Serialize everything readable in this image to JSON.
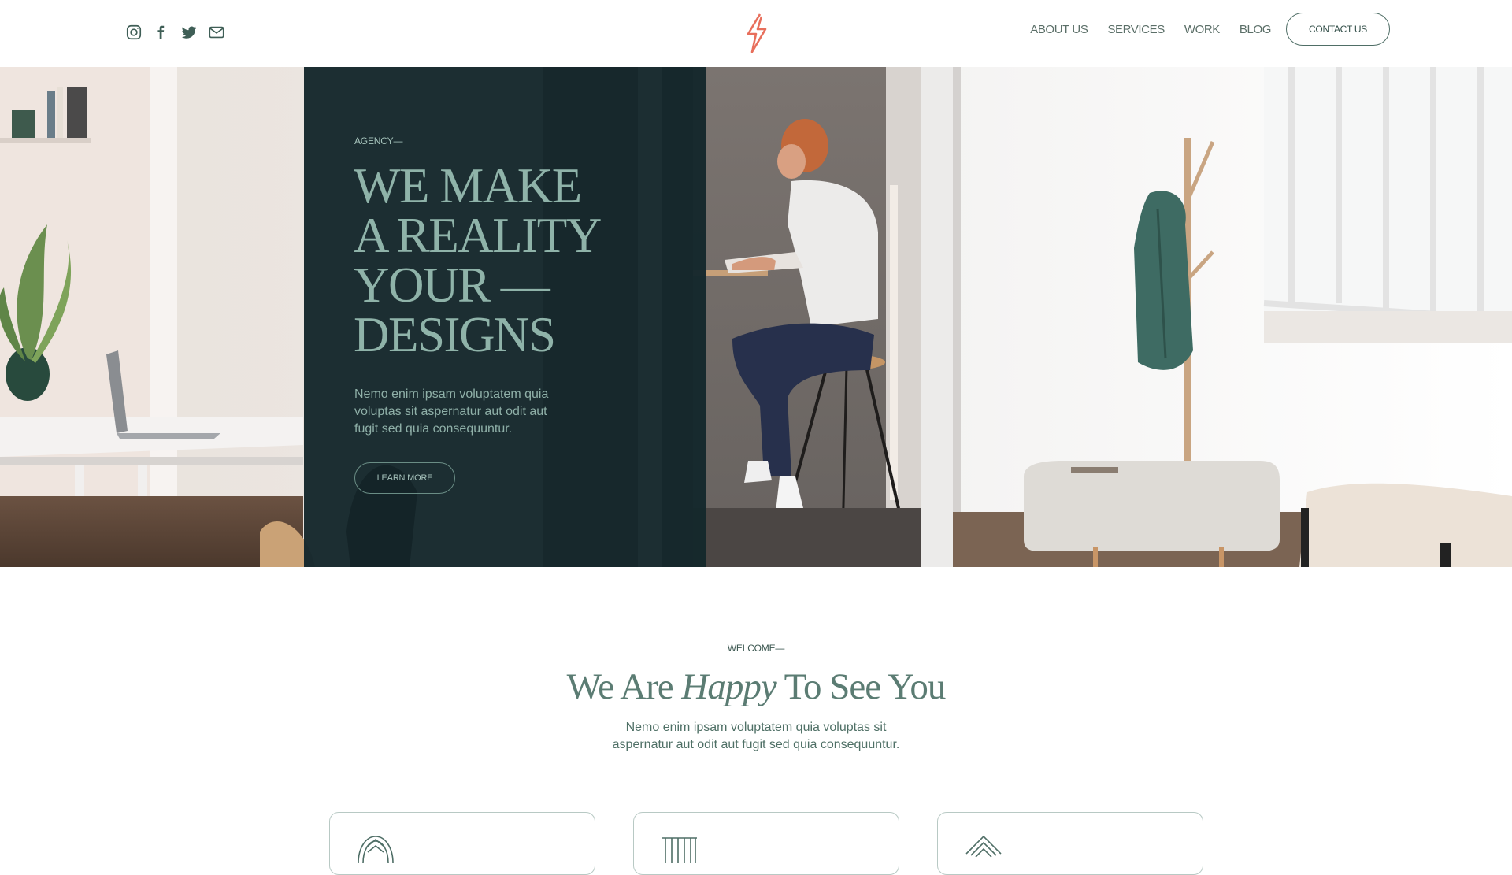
{
  "header": {
    "socials": [
      {
        "icon": "instagram-icon"
      },
      {
        "icon": "facebook-icon"
      },
      {
        "icon": "twitter-icon"
      },
      {
        "icon": "mail-icon"
      }
    ],
    "logo": {
      "icon": "lightning-bolt-logo",
      "color": "#e86f5c"
    },
    "nav": {
      "about": "ABOUT US",
      "services": "SERVICES",
      "work": "WORK",
      "blog": "BLOG",
      "contact": "CONTACT US"
    }
  },
  "hero": {
    "eyebrow": "AGENCY—",
    "title_lines": [
      "WE MAKE",
      "A REALITY",
      "YOUR —",
      "DESIGNS"
    ],
    "description": "Nemo enim ipsam voluptatem quia voluptas sit aspernatur aut odit aut fugit sed quia consequuntur.",
    "button": "LEARN MORE",
    "overlay_color": "#132429",
    "accent_text_color": "#8fb3a9"
  },
  "welcome": {
    "eyebrow": "WELCOME—",
    "title_before": "We Are ",
    "title_emphasis": "Happy",
    "title_after": " To See You",
    "description": "Nemo enim ipsam voluptatem quia voluptas sit aspernatur aut odit aut fugit sed quia consequuntur."
  },
  "cards": [
    {
      "icon": "arch-icon"
    },
    {
      "icon": "columns-icon"
    },
    {
      "icon": "roof-icon"
    }
  ],
  "colors": {
    "brand_red": "#e86f5c",
    "text_green": "#4f7066",
    "dark_overlay": "#132429"
  }
}
